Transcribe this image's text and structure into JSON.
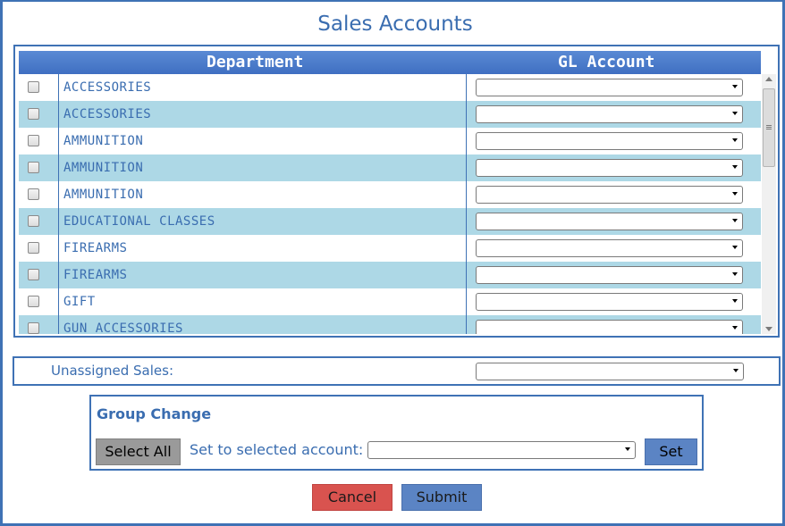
{
  "title": "Sales Accounts",
  "grid": {
    "headers": {
      "department": "Department",
      "gl_account": "GL Account"
    },
    "rows": [
      {
        "department": "ACCESSORIES",
        "gl_account": ""
      },
      {
        "department": "ACCESSORIES",
        "gl_account": ""
      },
      {
        "department": "AMMUNITION",
        "gl_account": ""
      },
      {
        "department": "AMMUNITION",
        "gl_account": ""
      },
      {
        "department": "AMMUNITION",
        "gl_account": ""
      },
      {
        "department": "EDUCATIONAL CLASSES",
        "gl_account": ""
      },
      {
        "department": "FIREARMS",
        "gl_account": ""
      },
      {
        "department": "FIREARMS",
        "gl_account": ""
      },
      {
        "department": "GIFT",
        "gl_account": ""
      },
      {
        "department": "GUN ACCESSORIES",
        "gl_account": ""
      }
    ]
  },
  "unassigned": {
    "label": "Unassigned Sales:",
    "value": ""
  },
  "group_change": {
    "title": "Group Change",
    "select_all_label": "Select All",
    "set_to_label": "Set to selected account:",
    "account_value": "",
    "set_label": "Set"
  },
  "actions": {
    "cancel_label": "Cancel",
    "submit_label": "Submit"
  },
  "colors": {
    "accent": "#3f72b5",
    "row_alt": "#add8e6",
    "cancel": "#d9534f",
    "primary_button": "#5b84c4"
  }
}
